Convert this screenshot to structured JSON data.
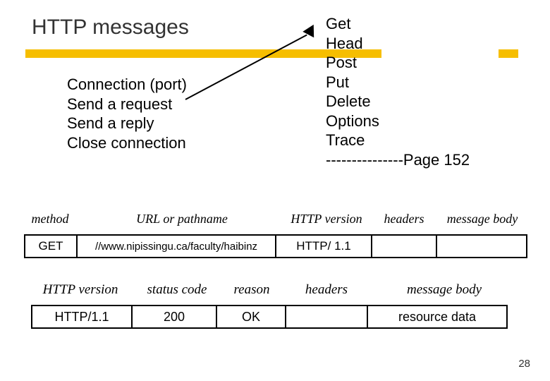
{
  "title": "HTTP messages",
  "connection_steps": [
    "Connection (port)",
    "Send a request",
    "Send a reply",
    "Close connection"
  ],
  "http_methods": [
    "Get",
    "Head",
    "Post",
    "Put",
    "Delete",
    "Options",
    "Trace",
    "---------------Page 152"
  ],
  "request_table": {
    "headers": [
      "method",
      "URL or pathname",
      "HTTP version",
      "headers",
      "message body"
    ],
    "row": [
      "GET",
      "//www.nipissingu.ca/faculty/haibinz",
      "HTTP/ 1.1",
      "",
      ""
    ]
  },
  "response_table": {
    "headers": [
      "HTTP version",
      "status code",
      "reason",
      "headers",
      "message body"
    ],
    "row": [
      "HTTP/1.1",
      "200",
      "OK",
      "",
      "resource data"
    ]
  },
  "page_number": "28"
}
